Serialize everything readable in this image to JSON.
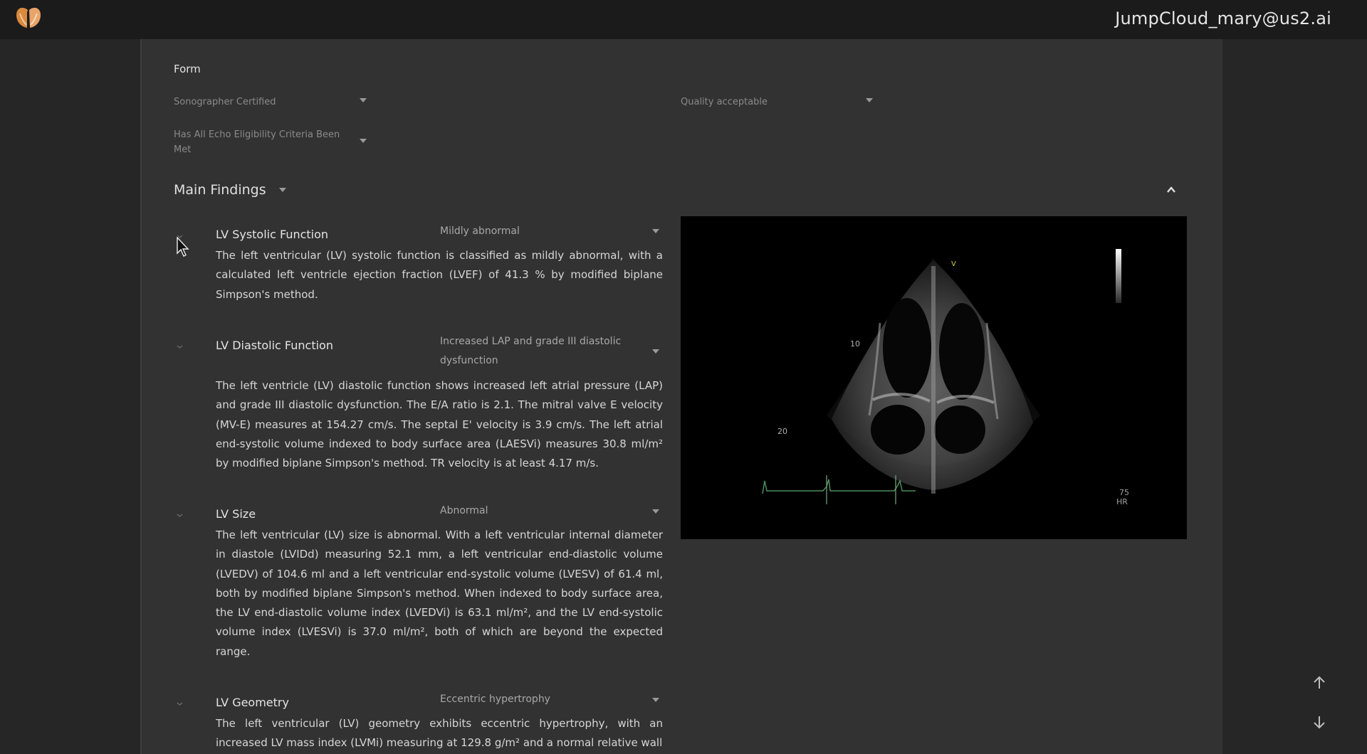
{
  "header": {
    "user": "JumpCloud_mary@us2.ai",
    "logo_icon": "butterfly-logo-icon"
  },
  "form": {
    "label": "Form",
    "sonographer": "Sonographer Certified",
    "quality": "Quality acceptable",
    "eligibility": "Has All Echo Eligibility Criteria Been Met"
  },
  "main_findings": {
    "title": "Main Findings",
    "findings": [
      {
        "title": "LV Systolic Function",
        "value": "Mildly abnormal",
        "text": "The left ventricular (LV) systolic function is classified as mildly abnormal, with a calculated left ventricle ejection fraction (LVEF) of 41.3 % by modified biplane Simpson's method."
      },
      {
        "title": "LV Diastolic Function",
        "value": "Increased LAP and grade III diastolic dysfunction",
        "text": "The left ventricle (LV) diastolic function shows increased left atrial pressure (LAP) and grade III diastolic dysfunction. The E/A ratio is 2.1. The mitral valve E velocity (MV-E) measures at 154.27 cm/s. The septal E' velocity is 3.9 cm/s. The left atrial end-systolic volume indexed to body surface area (LAESVi) measures 30.8 ml/m² by modified biplane Simpson's method. TR velocity is at least 4.17 m/s."
      },
      {
        "title": "LV Size",
        "value": "Abnormal",
        "text": "The left ventricular (LV) size is abnormal. With a left ventricular internal diameter in diastole (LVIDd) measuring 52.1 mm, a left ventricular end-diastolic volume (LVEDV) of 104.6 ml and a left ventricular end-systolic volume (LVESV) of 61.4 ml, both by modified biplane Simpson's method. When indexed to body surface area, the LV end-diastolic volume index (LVEDVi) is 63.1 ml/m², and the LV end-systolic volume index (LVESVi) is 37.0 ml/m², both of which are beyond the expected range."
      },
      {
        "title": "LV Geometry",
        "value": "Eccentric hypertrophy",
        "text": "The left ventricular (LV) geometry exhibits eccentric hypertrophy, with an increased LV mass index (LVMi) measuring at 129.8 g/m² and a normal relative wall"
      }
    ]
  },
  "echo_image": {
    "depth_label_1": "10",
    "depth_label_2": "20",
    "hr_value": "75",
    "hr_label": "HR",
    "marker": "V"
  },
  "icons": {
    "scroll_up": "arrow-up-icon",
    "scroll_down": "arrow-down-icon",
    "collapse": "chevron-up-icon",
    "cursor": "mouse-pointer-icon"
  }
}
